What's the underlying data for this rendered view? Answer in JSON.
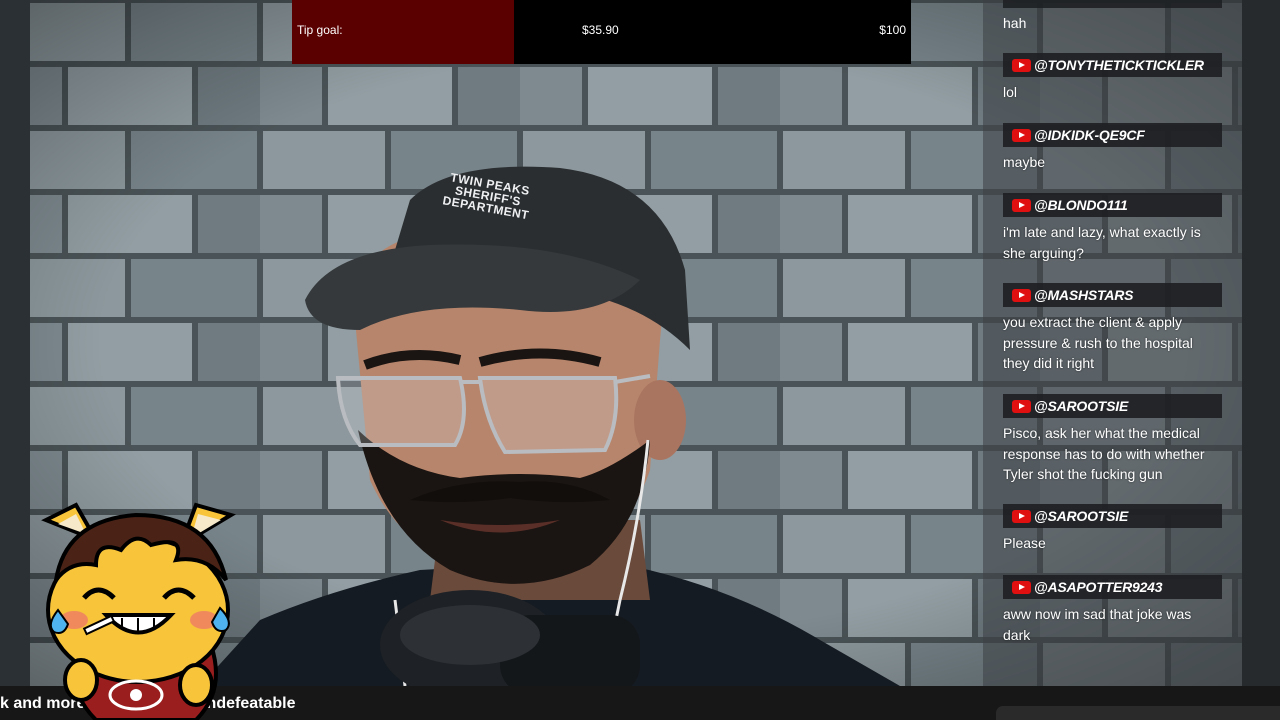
{
  "tip_goal": {
    "label": "Tip goal:",
    "current": "$35.90",
    "target": "$100",
    "progress_fraction": 0.359,
    "fill_color": "#5a0000"
  },
  "chat": {
    "first_message_text": "hah",
    "platform_icon": "youtube-icon",
    "messages": [
      {
        "author": "@TONYTHETICKTICKLER",
        "text": "lol"
      },
      {
        "author": "@IDKIDK-QE9CF",
        "text": "maybe"
      },
      {
        "author": "@BLONDO111",
        "text": "i'm late and lazy, what exactly is she arguing?"
      },
      {
        "author": "@MASHSTARS",
        "text": "you extract the client & apply pressure & rush to the hospital they did it right"
      },
      {
        "author": "@SAROOTSIE",
        "text": "Pisco, ask her what the medical response has to do with whether Tyler shot the fucking gun"
      },
      {
        "author": "@SAROOTSIE",
        "text": "Please"
      },
      {
        "author": "@ASAPOTTER9243",
        "text": "aww now im sad that joke was dark"
      }
    ]
  },
  "scene": {
    "cap_text_line1": "TWIN PEAKS",
    "cap_text_line2": "SHERIFF'S",
    "cap_text_line3": "DEPARTMENT"
  },
  "ticker": {
    "left_text": "k and more",
    "right_text": "nd Undefeatable"
  },
  "mascot": {
    "icon": "laughing-cat-mascot-icon"
  }
}
